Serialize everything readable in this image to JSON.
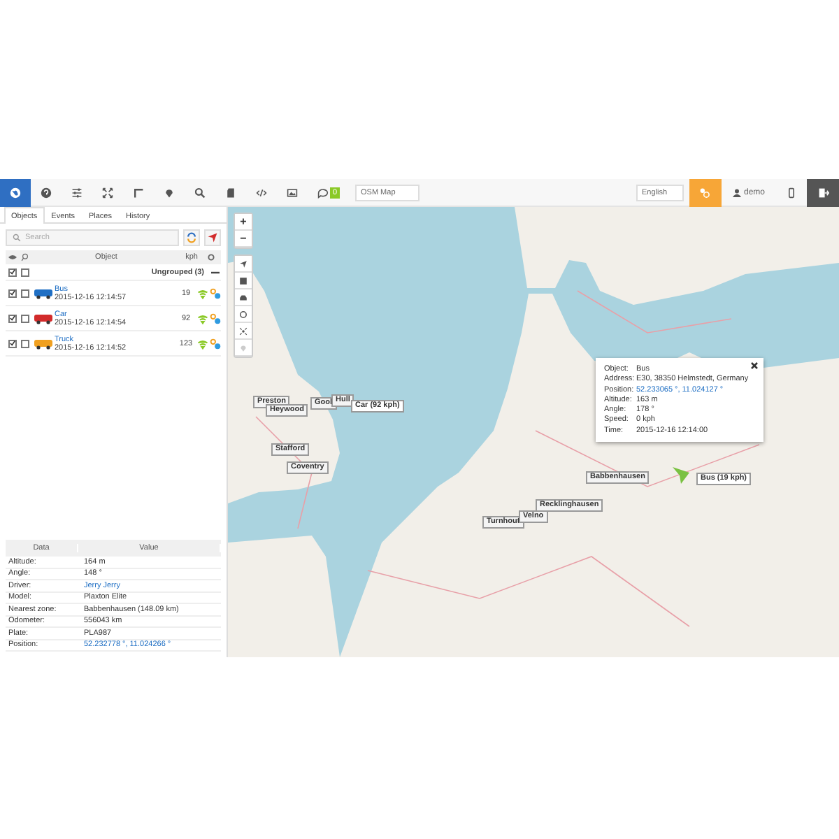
{
  "toolbar": {
    "map_select": "OSM Map",
    "chat_count": "0",
    "language": "English",
    "user": "demo"
  },
  "tabs": [
    {
      "label": "Objects",
      "selected": true
    },
    {
      "label": "Events",
      "selected": false
    },
    {
      "label": "Places",
      "selected": false
    },
    {
      "label": "History",
      "selected": false
    }
  ],
  "search": {
    "placeholder": "Search"
  },
  "object_table": {
    "columns": [
      "Object",
      "kph"
    ],
    "group": {
      "name": "Ungrouped (3)",
      "visible": true,
      "follow": false
    },
    "rows": [
      {
        "name": "Bus",
        "time": "2015-12-16 12:14:57",
        "speed": "19",
        "color": "#1f6fc4",
        "visible": true,
        "follow": false
      },
      {
        "name": "Car",
        "time": "2015-12-16 12:14:54",
        "speed": "92",
        "color": "#d22b2b",
        "visible": true,
        "follow": false
      },
      {
        "name": "Truck",
        "time": "2015-12-16 12:14:52",
        "speed": "123",
        "color": "#f0a020",
        "visible": true,
        "follow": false
      }
    ]
  },
  "data_table": {
    "columns": [
      "Data",
      "Value"
    ],
    "rows": [
      {
        "label": "Altitude:",
        "value": "164 m",
        "kind": "text"
      },
      {
        "label": "Angle:",
        "value": "148 °",
        "kind": "text"
      },
      {
        "label": "Driver:",
        "value": "Jerry Jerry",
        "kind": "link"
      },
      {
        "label": "Model:",
        "value": "Plaxton Elite",
        "kind": "text"
      },
      {
        "label": "Nearest zone:",
        "value": "Babbenhausen (148.09 km)",
        "kind": "text"
      },
      {
        "label": "Odometer:",
        "value": "556043 km",
        "kind": "text"
      },
      {
        "label": "Plate:",
        "value": "PLA987",
        "kind": "text"
      },
      {
        "label": "Position:",
        "value": "52.232778 °, 11.024266 °",
        "kind": "link"
      }
    ]
  },
  "map": {
    "zoom_in": "+",
    "zoom_out": "−",
    "labels": [
      {
        "text": "Preston",
        "kind": "zone"
      },
      {
        "text": "Heywood",
        "kind": "zone"
      },
      {
        "text": "Gool",
        "kind": "zone"
      },
      {
        "text": "Hull",
        "kind": "zone"
      },
      {
        "text": "Car (92 kph)",
        "kind": "object"
      },
      {
        "text": "Stafford",
        "kind": "zone"
      },
      {
        "text": "Coventry",
        "kind": "zone"
      },
      {
        "text": "Babbenhausen",
        "kind": "zone"
      },
      {
        "text": "Bus (19 kph)",
        "kind": "object"
      },
      {
        "text": "Recklinghausen",
        "kind": "zone"
      },
      {
        "text": "Turnhout",
        "kind": "zone"
      },
      {
        "text": "Velno",
        "kind": "zone"
      }
    ],
    "popup": [
      {
        "label": "Object:",
        "value": "Bus",
        "kind": "text"
      },
      {
        "label": "Address:",
        "value": "E30, 38350 Helmstedt, Germany",
        "kind": "text"
      },
      {
        "label": "Position:",
        "value": "52.233065 °, 11.024127 °",
        "kind": "link"
      },
      {
        "label": "Altitude:",
        "value": "163 m",
        "kind": "text"
      },
      {
        "label": "Angle:",
        "value": "178 °",
        "kind": "text"
      },
      {
        "label": "Speed:",
        "value": "0 kph",
        "kind": "text"
      },
      {
        "label": "Time:",
        "value": "2015-12-16 12:14:00",
        "kind": "text"
      }
    ]
  }
}
